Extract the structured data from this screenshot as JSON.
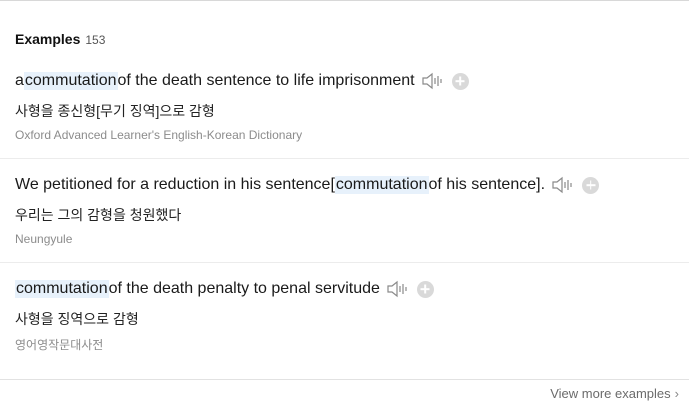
{
  "header": {
    "title": "Examples",
    "count": "153"
  },
  "examples": [
    {
      "pre": "a ",
      "highlight": "commutation",
      "post": " of the death sentence to life imprisonment",
      "translation": "사형을 종신형[무기 징역]으로 감형",
      "source": "Oxford Advanced Learner's English-Korean Dictionary"
    },
    {
      "pre": "We petitioned for a reduction in his sentence[",
      "highlight": "commutation",
      "post": " of his sentence].",
      "translation": "우리는 그의 감형을 청원했다",
      "source": "Neungyule"
    },
    {
      "pre": "",
      "highlight": "commutation",
      "post": " of the death penalty to penal servitude",
      "translation": "사형을 징역으로 감형",
      "source": "영어영작문대사전"
    }
  ],
  "footer": {
    "more_label": "View more examples",
    "chevron": "›"
  },
  "icons": {
    "speaker": "speaker-icon",
    "add": "add-circle-icon"
  },
  "colors": {
    "highlight_bg": "#e7f1fb",
    "source_text": "#8c8c8c"
  }
}
